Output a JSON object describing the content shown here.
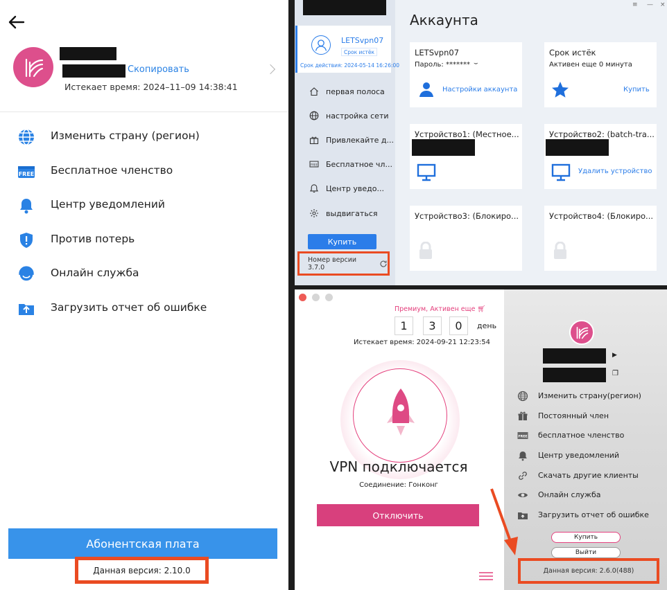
{
  "colors": {
    "accent_blue": "#3893ea",
    "brand_pink": "#dd4f8c",
    "highlight_red": "#ea4b22",
    "win_blue": "#2b7de9"
  },
  "mobile": {
    "copy_label": "Скопировать",
    "expire": "Истекает время: 2024–11–09 14:38:41",
    "menu": [
      {
        "label": "Изменить страну (регион)",
        "icon": "globe-icon"
      },
      {
        "label": "Бесплатное членство",
        "icon": "free-badge-icon"
      },
      {
        "label": "Центр уведомлений",
        "icon": "bell-icon"
      },
      {
        "label": "Против потерь",
        "icon": "shield-alert-icon"
      },
      {
        "label": "Онлайн служба",
        "icon": "headset-icon"
      },
      {
        "label": "Загрузить отчет об ошибке",
        "icon": "upload-icon"
      }
    ],
    "subscribe_label": "Абонентская плата",
    "version": "Данная версия: 2.10.0"
  },
  "desktop": {
    "username": "LETSvpn07",
    "expired_chip": "Срок истёк",
    "valid_until": "Срок действия: 2024-05-14 16:26:00",
    "sidebar": [
      {
        "label": "первая полоса",
        "icon": "home-icon"
      },
      {
        "label": "настройка сети",
        "icon": "globe-icon"
      },
      {
        "label": "Привлекайте д...",
        "icon": "gift-icon"
      },
      {
        "label": "Бесплатное чл...",
        "icon": "free-badge-icon"
      },
      {
        "label": "Центр уведо...",
        "icon": "bell-icon"
      },
      {
        "label": "выдвигаться",
        "icon": "settings-icon"
      }
    ],
    "buy_label": "Купить",
    "version": "Номер версии 3.7.0",
    "title": "Аккаунта",
    "account_card": {
      "title": "LETSvpn07",
      "password": "Пароль: *******",
      "link": "Настройки аккаунта"
    },
    "status_card": {
      "title": "Срок истёк",
      "sub": "Активен еще 0 минута",
      "link": "Купить"
    },
    "devices": [
      {
        "title": "Устройство1: (Местное...",
        "link": ""
      },
      {
        "title": "Устройство2: (batch-tra...",
        "link": "Удалить устройство"
      },
      {
        "title": "Устройство3: (Блокиро...",
        "link": ""
      },
      {
        "title": "Устройство4: (Блокиро...",
        "link": ""
      }
    ]
  },
  "mac": {
    "premium": "Премиум, Активен еще",
    "days": [
      "1",
      "3",
      "0"
    ],
    "day_label": "день",
    "expire": "Истекает время: 2024-09-21 12:23:54",
    "status": "VPN подключается",
    "connection": "Соединение: Гонконг",
    "disconnect_label": "Отключить",
    "menu": [
      {
        "label": "Изменить страну(регион)",
        "icon": "globe-icon"
      },
      {
        "label": "Постоянный член",
        "icon": "gift-icon"
      },
      {
        "label": "бесплатное членство",
        "icon": "free-badge-icon"
      },
      {
        "label": "Центр уведомлений",
        "icon": "bell-icon"
      },
      {
        "label": "Скачать другие клиенты",
        "icon": "link-icon"
      },
      {
        "label": "Онлайн служба",
        "icon": "eye-icon"
      },
      {
        "label": "Загрузить отчет об ошибке",
        "icon": "upload-icon"
      }
    ],
    "buy_label": "Купить",
    "logout_label": "Выйти",
    "version": "Данная версия: 2.6.0(488)"
  }
}
